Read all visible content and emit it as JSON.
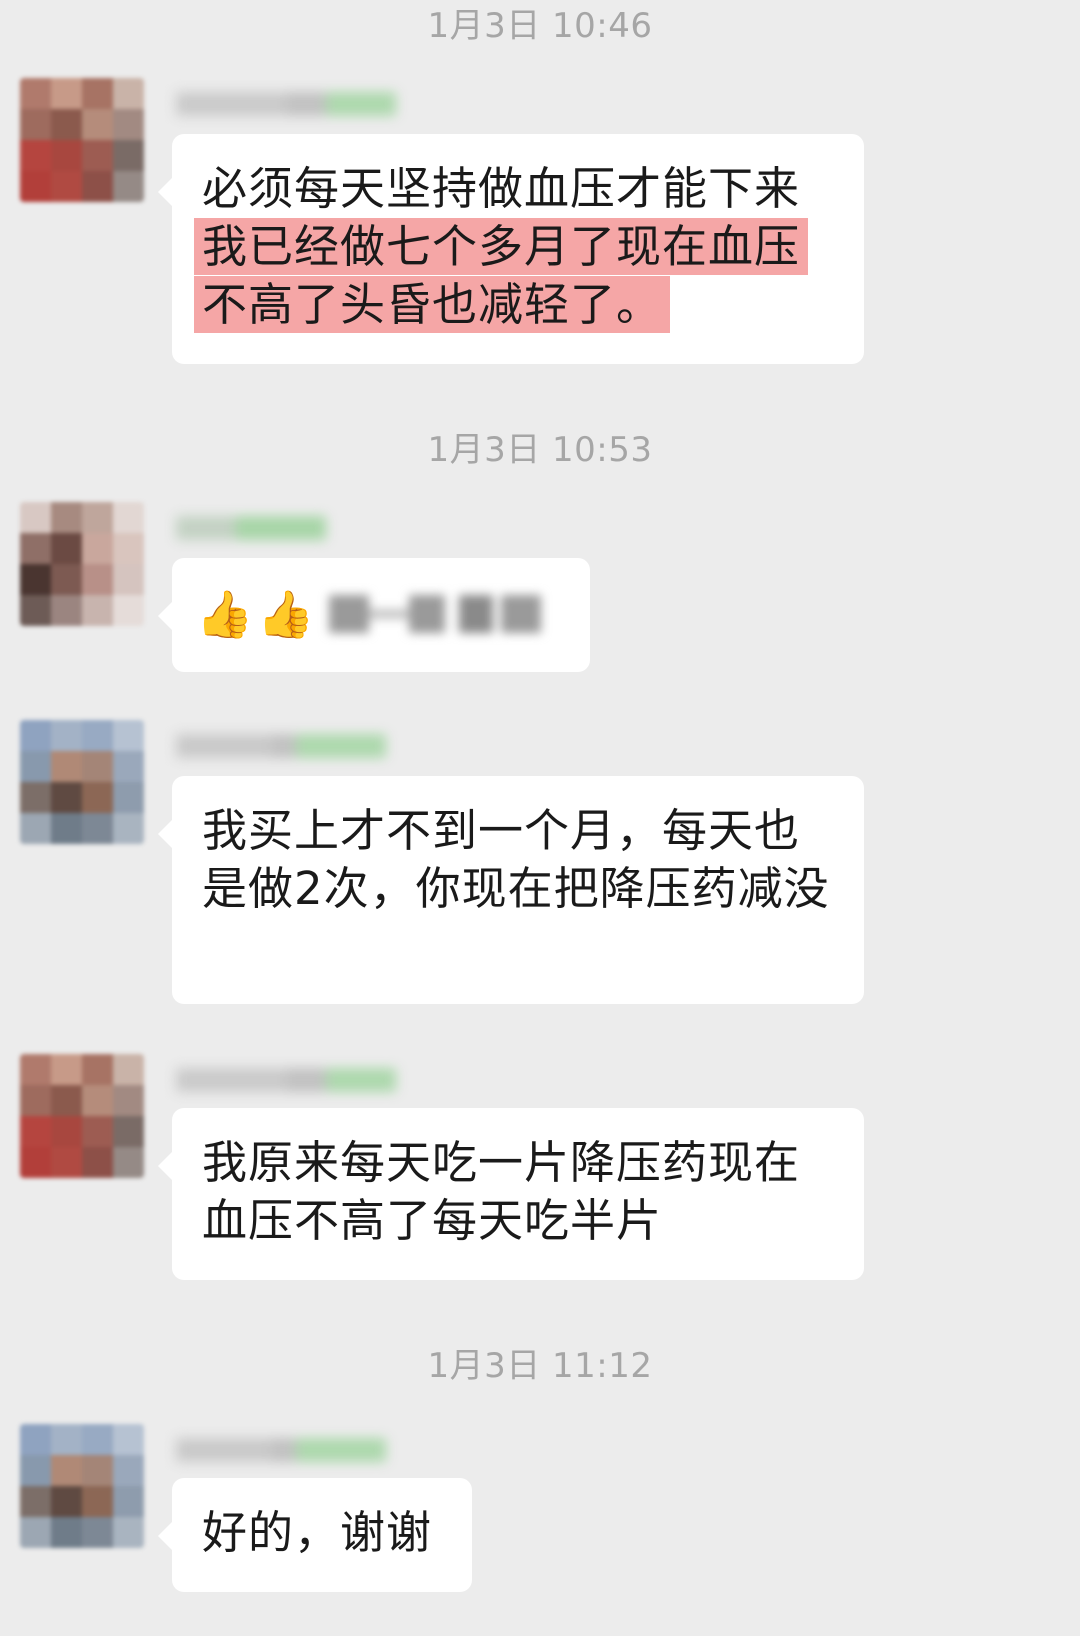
{
  "conversation": {
    "timestamps": [
      "1月3日 10:46",
      "1月3日 10:53",
      "1月3日 11:12"
    ],
    "messages": [
      {
        "id": "m1",
        "text_plain": "必须每天坚持做血压才能下来",
        "text_highlight": "我已经做七个多月了现在血压不高了头昏也减轻了。",
        "highlight_color": "#f5a6a6"
      },
      {
        "id": "m2",
        "emojis": [
          "👍",
          "👍"
        ],
        "text_redacted": true
      },
      {
        "id": "m3",
        "text": "我买上才不到一个月，每天也是做2次，你现在把降压药减没"
      },
      {
        "id": "m4",
        "text": "我原来每天吃一片降压药现在血压不高了每天吃半片"
      },
      {
        "id": "m5",
        "text": "好的，谢谢"
      }
    ]
  },
  "theme": {
    "background": "#ececec",
    "bubble": "#ffffff",
    "timestamp_color": "#a6a6a6",
    "text_color": "#1a1a1a"
  }
}
